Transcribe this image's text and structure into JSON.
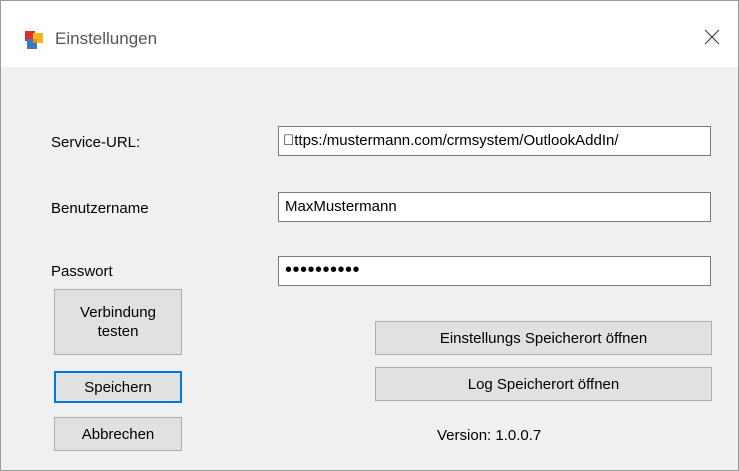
{
  "window": {
    "title": "Einstellungen",
    "close_symbol": "✕"
  },
  "fields": {
    "service_url": {
      "label": "Service-URL:",
      "value": "\u0000ttps:/mustermann.com/crmsystem/OutlookAddIn/"
    },
    "username": {
      "label": "Benutzername",
      "value": "MaxMustermann"
    },
    "password": {
      "label": "Passwort",
      "value": "••••••••••"
    }
  },
  "buttons": {
    "test_connection": "Verbindung testen",
    "save": "Speichern",
    "cancel": "Abbrechen",
    "open_settings_location": "Einstellungs Speicherort öffnen",
    "open_log_location": "Log Speicherort öffnen"
  },
  "version": "Version: 1.0.0.7",
  "icons": {
    "app": "app-icon",
    "close": "close-icon"
  },
  "colors": {
    "accent_border": "#0078d7",
    "button_bg": "#e1e1e1",
    "dialog_bg": "#f0f0f0"
  }
}
